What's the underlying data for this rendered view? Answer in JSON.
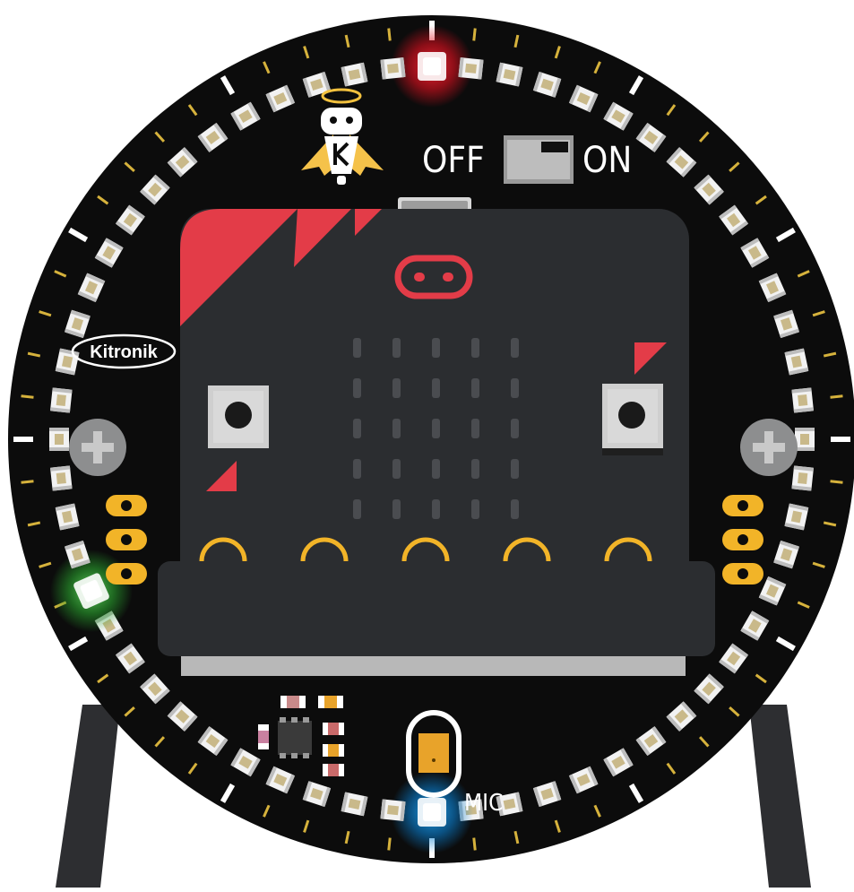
{
  "board": {
    "switch": {
      "off_label": "OFF",
      "on_label": "ON",
      "state": "on"
    },
    "brand": "Kitronik",
    "mic_label": "MIC",
    "ring": {
      "led_count": 60,
      "lit": [
        {
          "index": 0,
          "color": "#ff1a2e",
          "name": "red"
        },
        {
          "index": 30,
          "color": "#14a6ff",
          "name": "blue"
        },
        {
          "index": 41,
          "color": "#3fd24a",
          "name": "green"
        }
      ]
    },
    "microbit": {
      "led_matrix": {
        "rows": 5,
        "cols": 5
      },
      "buttons": [
        "button-a",
        "button-b"
      ],
      "edge_pins": 5
    }
  },
  "colors": {
    "board": "#0c0c0c",
    "microbit": "#2b2d30",
    "accent": "#e33c48",
    "pads": "#f2b428",
    "ticks": "#d6b23c"
  }
}
